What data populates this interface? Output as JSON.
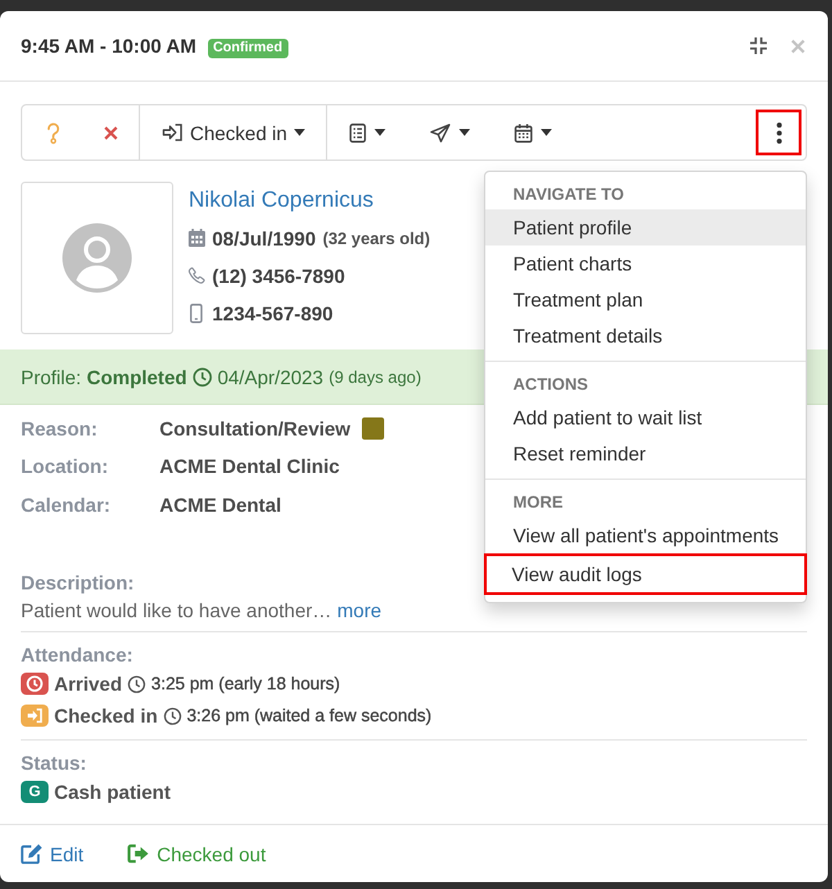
{
  "header": {
    "time_range": "9:45 AM - 10:00 AM",
    "status_badge": "Confirmed"
  },
  "toolbar": {
    "status_button": {
      "label": "Checked in"
    },
    "more_button": {
      "expanded": true,
      "highlighted": true
    }
  },
  "menu": {
    "sections": [
      {
        "heading": "NAVIGATE TO",
        "items": [
          {
            "label": "Patient profile",
            "hovered": true,
            "highlighted": false
          },
          {
            "label": "Patient charts",
            "hovered": false,
            "highlighted": false
          },
          {
            "label": "Treatment plan",
            "hovered": false,
            "highlighted": false
          },
          {
            "label": "Treatment details",
            "hovered": false,
            "highlighted": false
          }
        ]
      },
      {
        "heading": "ACTIONS",
        "items": [
          {
            "label": "Add patient to wait list",
            "hovered": false,
            "highlighted": false
          },
          {
            "label": "Reset reminder",
            "hovered": false,
            "highlighted": false
          }
        ]
      },
      {
        "heading": "MORE",
        "items": [
          {
            "label": "View all patient's appointments",
            "hovered": false,
            "highlighted": false
          },
          {
            "label": "View audit logs",
            "hovered": false,
            "highlighted": true
          }
        ]
      }
    ]
  },
  "patient": {
    "name": "Nikolai Copernicus",
    "birth_date": "08/Jul/1990",
    "age": "(32 years old)",
    "phone": "(12) 3456-7890",
    "mobile": "1234-567-890"
  },
  "profile": {
    "status": "Profile: **Completed**",
    "date": "04/Apr/2023",
    "relative": "(9 days ago)"
  },
  "details": [
    {
      "label": "Reason:",
      "value": "Consultation/Review",
      "color": "#857719"
    },
    {
      "label": "Location:",
      "value": "ACME Dental Clinic"
    },
    {
      "label": "Calendar:",
      "value": "ACME Dental"
    }
  ],
  "description": {
    "label": "Description:",
    "text": "Patient would like to have another…",
    "more_link": "more"
  },
  "attendance": {
    "label": "Attendance:",
    "events": [
      {
        "kind": "arrived",
        "color": "#d9534f",
        "label": "Arrived",
        "time": "3:25 pm (early 18 hours)"
      },
      {
        "kind": "checked-in",
        "color": "#f0ad4e",
        "label": "Checked in",
        "time": "3:26 pm (waited a few seconds)"
      }
    ]
  },
  "status": {
    "label": "Status:",
    "badge": "G",
    "color": "#138d75",
    "value": "Cash patient"
  },
  "footer": {
    "actions": [
      {
        "kind": "edit",
        "label": "Edit"
      },
      {
        "kind": "check-out",
        "label": "Checked out"
      }
    ]
  }
}
